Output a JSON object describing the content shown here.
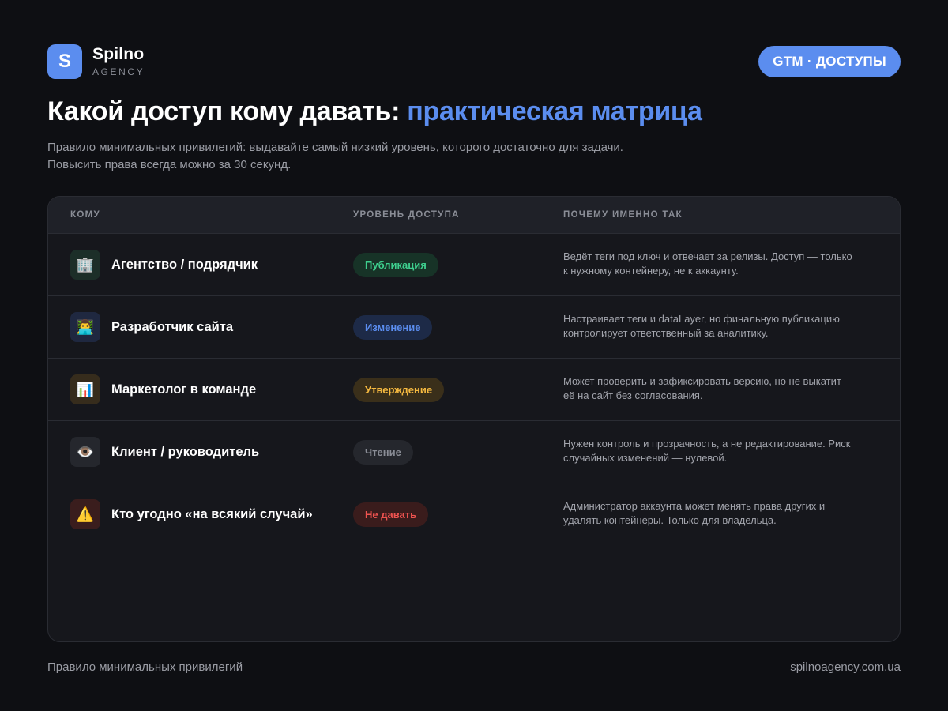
{
  "brand": {
    "logo_letter": "S",
    "name": "Spilno",
    "sub": "AGENCY",
    "color": "#5b8def"
  },
  "tag_pill": "GTM · ДОСТУПЫ",
  "title": {
    "main": "Какой доступ кому давать: ",
    "accent": "практическая матрица"
  },
  "subtitle": {
    "line1": "Правило минимальных привилегий: выдавайте самый низкий уровень, которого достаточно для задачи.",
    "line2": "Повысить права всегда можно за 30 секунд."
  },
  "table": {
    "headers": {
      "who": "КОМУ",
      "level": "УРОВЕНЬ ДОСТУПА",
      "why": "ПОЧЕМУ ИМЕННО ТАК"
    },
    "rows": [
      {
        "icon": "building-icon",
        "glyph": "🏢",
        "icon_bg": "#1c2e28",
        "who": "Агентство / подрядчик",
        "level": "Публикация",
        "level_color": "#3ecf8e",
        "level_bg": "#173327",
        "why_line1": "Ведёт теги под ключ и отвечает за релизы. Доступ — только",
        "why_line2": "к нужному контейнеру, не к аккаунту."
      },
      {
        "icon": "developer-icon",
        "glyph": "👨‍💻",
        "icon_bg": "#1f2840",
        "who": "Разработчик сайта",
        "level": "Изменение",
        "level_color": "#5b8def",
        "level_bg": "#1d2a47",
        "why_line1": "Настраивает теги и dataLayer, но финальную публикацию",
        "why_line2": "контролирует ответственный за аналитику."
      },
      {
        "icon": "chart-icon",
        "glyph": "📊",
        "icon_bg": "#362c1c",
        "who": "Маркетолог в команде",
        "level": "Утверждение",
        "level_color": "#f5b940",
        "level_bg": "#3a2f1a",
        "why_line1": "Может проверить и зафиксировать версию, но не выкатит",
        "why_line2": "её на сайт без согласования."
      },
      {
        "icon": "eye-icon",
        "glyph": "👁️",
        "icon_bg": "#25272d",
        "who": "Клиент / руководитель",
        "level": "Чтение",
        "level_color": "#8a8d96",
        "level_bg": "#25272d",
        "why_line1": "Нужен контроль и прозрачность, а не редактирование. Риск",
        "why_line2": "случайных изменений — нулевой."
      },
      {
        "icon": "warning-icon",
        "glyph": "⚠️",
        "icon_bg": "#3a1d1d",
        "who": "Кто угодно «на всякий случай»",
        "level": "Не давать",
        "level_color": "#ef5350",
        "level_bg": "#3a1c1c",
        "why_line1": "Администратор аккаунта может менять права других и",
        "why_line2": "удалять контейнеры. Только для владельца."
      }
    ]
  },
  "footer": {
    "left": "Правило минимальных привилегий",
    "right": "spilnoagency.com.ua"
  }
}
